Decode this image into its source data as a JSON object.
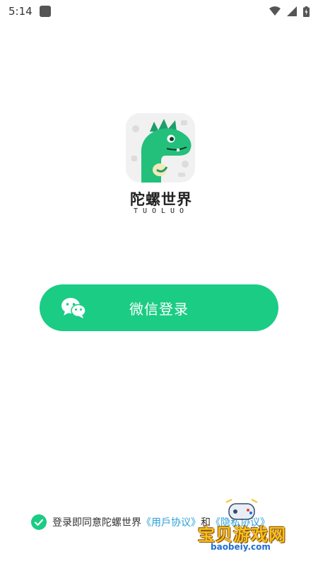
{
  "status_bar": {
    "time": "5:14"
  },
  "brand": {
    "name_cn": "陀螺世界",
    "name_en": "TUOLUO"
  },
  "login_button": {
    "label": "微信登录"
  },
  "agreement": {
    "prefix": "登录即同意陀螺世界",
    "user_agreement": "《用戶协议》",
    "connector": "和",
    "privacy_agreement": "《隐私协议》"
  },
  "watermark": {
    "title": "宝贝游戏网",
    "url": "baobeiy.com"
  },
  "colors": {
    "accent": "#1bcc84",
    "link": "#2aa0d8"
  }
}
